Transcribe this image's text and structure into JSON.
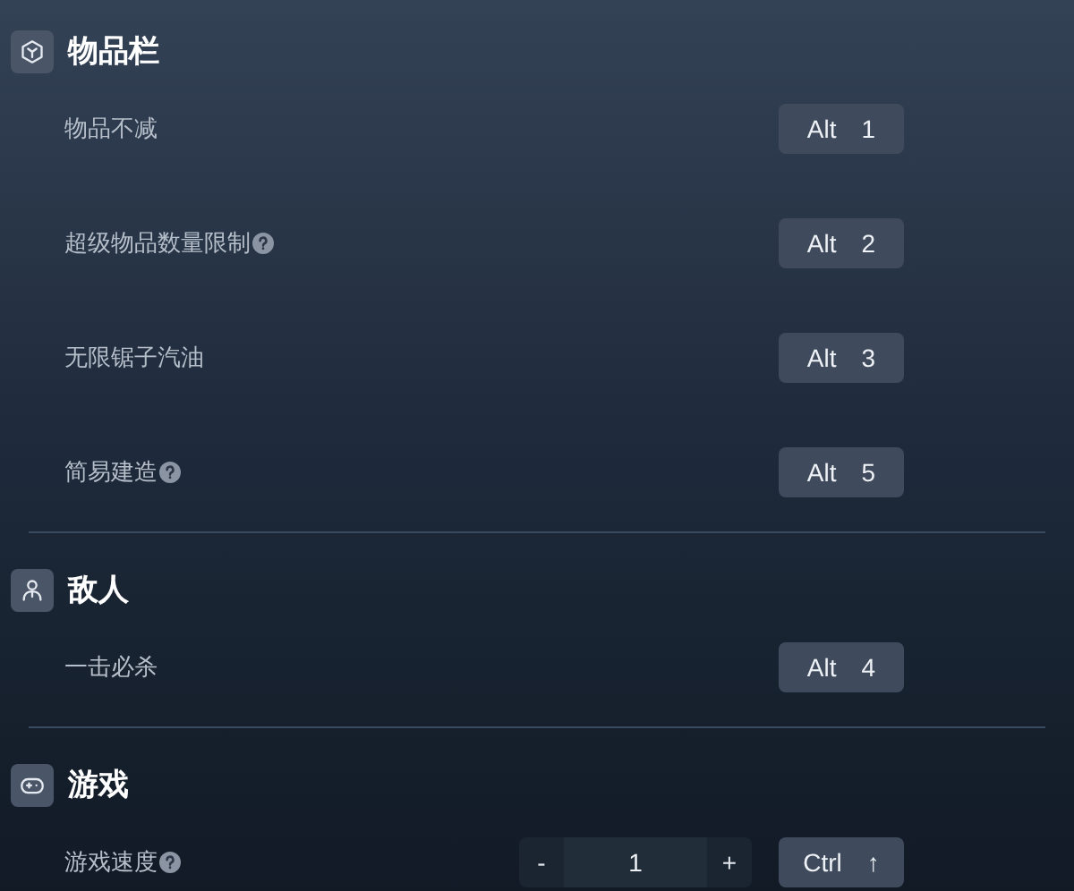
{
  "sections": [
    {
      "title": "物品栏",
      "items": [
        {
          "kind": "hotkey",
          "label": "物品不减",
          "help": false,
          "keys": [
            "Alt",
            "1"
          ]
        },
        {
          "kind": "hotkey",
          "label": "超级物品数量限制",
          "help": true,
          "keys": [
            "Alt",
            "2"
          ]
        },
        {
          "kind": "hotkey",
          "label": "无限锯子汽油",
          "help": false,
          "keys": [
            "Alt",
            "3"
          ]
        },
        {
          "kind": "hotkey",
          "label": "简易建造",
          "help": true,
          "keys": [
            "Alt",
            "5"
          ]
        }
      ]
    },
    {
      "title": "敌人",
      "items": [
        {
          "kind": "hotkey",
          "label": "一击必杀",
          "help": false,
          "keys": [
            "Alt",
            "4"
          ]
        }
      ]
    },
    {
      "title": "游戏",
      "items": [
        {
          "kind": "stepper",
          "label": "游戏速度",
          "help": true,
          "minus": "-",
          "value": "1",
          "plus": "+",
          "keys": [
            "Ctrl",
            "↑"
          ]
        }
      ]
    }
  ]
}
